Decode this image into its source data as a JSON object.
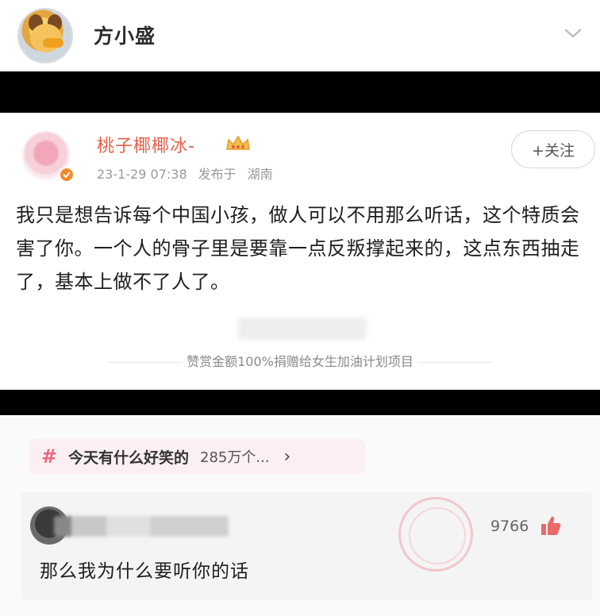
{
  "header": {
    "username": "方小盛"
  },
  "embedded_post": {
    "author": "桃子椰椰冰-",
    "timestamp": "23-1-29 07:38",
    "published_in": "发布于",
    "location": "湖南",
    "follow_label": "+关注",
    "body": "我只是想告诉每个中国小孩，做人可以不用那么听话，这个特质会害了你。一个人的骨子里是要靠一点反叛撑起来的，这点东西抽走了，基本上做不了人了。",
    "donation_note": "赞赏金额100%捐赠给女生加油计划项目"
  },
  "topic": {
    "icon": "hash-icon",
    "title": "今天有什么好笑的",
    "count": "285万个...",
    "chevron": "›"
  },
  "comment": {
    "likes": "9766",
    "text": "那么我为什么要听你的话"
  },
  "colors": {
    "author_name": "#e8604a",
    "topic_pill_bg": "#fbeff1",
    "hash_color": "#e8697f",
    "like_icon": "#e86a6a",
    "verify_badge": "#f08a2c"
  }
}
